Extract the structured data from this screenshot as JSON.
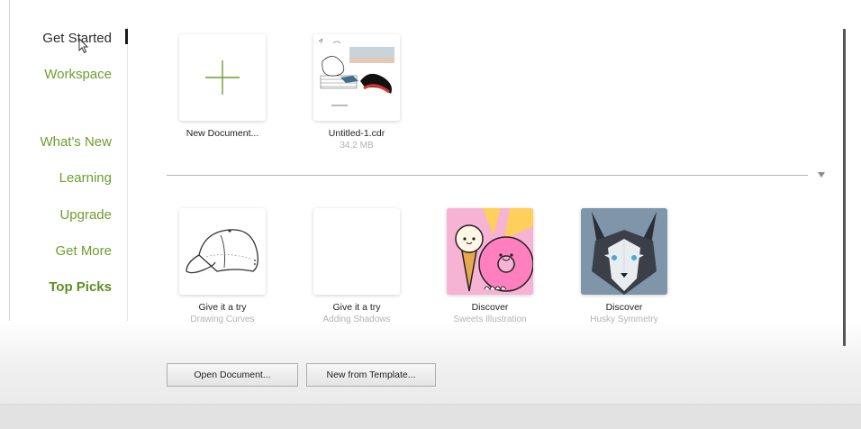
{
  "nav": {
    "items": [
      {
        "label": "Get Started"
      },
      {
        "label": "Workspace"
      },
      {
        "label": "What's New"
      },
      {
        "label": "Learning"
      },
      {
        "label": "Upgrade"
      },
      {
        "label": "Get More"
      },
      {
        "label": "Top Picks"
      }
    ]
  },
  "recent": [
    {
      "label": "New Document...",
      "sub": ""
    },
    {
      "label": "Untitled-1.cdr",
      "sub": "34.2 MB"
    }
  ],
  "picks": [
    {
      "label": "Give it a try",
      "sub": "Drawing Curves"
    },
    {
      "label": "Give it a try",
      "sub": "Adding Shadows"
    },
    {
      "label": "Discover",
      "sub": "Sweets Illustration"
    },
    {
      "label": "Discover",
      "sub": "Husky Symmetry"
    }
  ],
  "buttons": {
    "open_document": "Open Document...",
    "new_from_template": "New from Template..."
  },
  "colors": {
    "accent_green": "#6e9e2d",
    "active_text": "#2c2c2c",
    "muted_text": "#b3b3b3"
  }
}
